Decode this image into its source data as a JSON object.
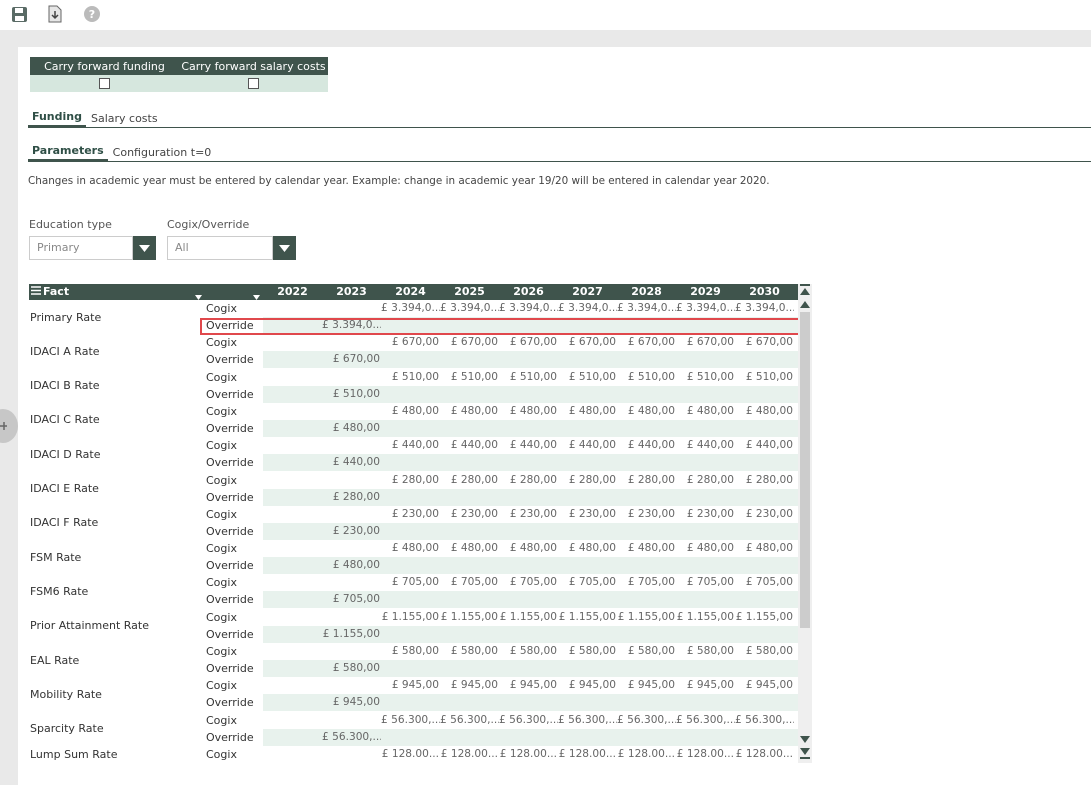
{
  "toolbar": {
    "icons": [
      "save-icon",
      "export-icon",
      "help-icon"
    ]
  },
  "carry_forward": {
    "headers": [
      "Carry forward funding",
      "Carry forward salary costs"
    ],
    "checked": [
      false,
      false
    ]
  },
  "tabs_main": [
    "Funding",
    "Salary costs"
  ],
  "tabs_sub": [
    "Parameters",
    "Configuration t=0"
  ],
  "note": "Changes in academic year must be entered by calendar year. Example: change in academic year 19/20 will be entered in calendar year 2020.",
  "filters": {
    "education_type": {
      "label": "Education type",
      "value": "Primary"
    },
    "cogix_override": {
      "label": "Cogix/Override",
      "value": "All"
    }
  },
  "grid": {
    "fact_header": "Fact",
    "years": [
      "2022",
      "2023",
      "2024",
      "2025",
      "2026",
      "2027",
      "2028",
      "2029",
      "2030"
    ],
    "sub_labels": [
      "Cogix",
      "Override"
    ],
    "rows": [
      {
        "name": "Primary Rate",
        "cogix": [
          "",
          "",
          "£ 3.394,0...",
          "£ 3.394,0...",
          "£ 3.394,0...",
          "£ 3.394,0...",
          "£ 3.394,0...",
          "£ 3.394,0...",
          "£ 3.394,0..."
        ],
        "override": [
          "",
          "£ 3.394,0...",
          "",
          "",
          "",
          "",
          "",
          "",
          ""
        ]
      },
      {
        "name": "IDACI A Rate",
        "cogix": [
          "",
          "",
          "£ 670,00",
          "£ 670,00",
          "£ 670,00",
          "£ 670,00",
          "£ 670,00",
          "£ 670,00",
          "£ 670,00"
        ],
        "override": [
          "",
          "£ 670,00",
          "",
          "",
          "",
          "",
          "",
          "",
          ""
        ]
      },
      {
        "name": "IDACI B Rate",
        "cogix": [
          "",
          "",
          "£ 510,00",
          "£ 510,00",
          "£ 510,00",
          "£ 510,00",
          "£ 510,00",
          "£ 510,00",
          "£ 510,00"
        ],
        "override": [
          "",
          "£ 510,00",
          "",
          "",
          "",
          "",
          "",
          "",
          ""
        ]
      },
      {
        "name": "IDACI C Rate",
        "cogix": [
          "",
          "",
          "£ 480,00",
          "£ 480,00",
          "£ 480,00",
          "£ 480,00",
          "£ 480,00",
          "£ 480,00",
          "£ 480,00"
        ],
        "override": [
          "",
          "£ 480,00",
          "",
          "",
          "",
          "",
          "",
          "",
          ""
        ]
      },
      {
        "name": "IDACI D Rate",
        "cogix": [
          "",
          "",
          "£ 440,00",
          "£ 440,00",
          "£ 440,00",
          "£ 440,00",
          "£ 440,00",
          "£ 440,00",
          "£ 440,00"
        ],
        "override": [
          "",
          "£ 440,00",
          "",
          "",
          "",
          "",
          "",
          "",
          ""
        ]
      },
      {
        "name": "IDACI E Rate",
        "cogix": [
          "",
          "",
          "£ 280,00",
          "£ 280,00",
          "£ 280,00",
          "£ 280,00",
          "£ 280,00",
          "£ 280,00",
          "£ 280,00"
        ],
        "override": [
          "",
          "£ 280,00",
          "",
          "",
          "",
          "",
          "",
          "",
          ""
        ]
      },
      {
        "name": "IDACI F Rate",
        "cogix": [
          "",
          "",
          "£ 230,00",
          "£ 230,00",
          "£ 230,00",
          "£ 230,00",
          "£ 230,00",
          "£ 230,00",
          "£ 230,00"
        ],
        "override": [
          "",
          "£ 230,00",
          "",
          "",
          "",
          "",
          "",
          "",
          ""
        ]
      },
      {
        "name": "FSM Rate",
        "cogix": [
          "",
          "",
          "£ 480,00",
          "£ 480,00",
          "£ 480,00",
          "£ 480,00",
          "£ 480,00",
          "£ 480,00",
          "£ 480,00"
        ],
        "override": [
          "",
          "£ 480,00",
          "",
          "",
          "",
          "",
          "",
          "",
          ""
        ]
      },
      {
        "name": "FSM6 Rate",
        "cogix": [
          "",
          "",
          "£ 705,00",
          "£ 705,00",
          "£ 705,00",
          "£ 705,00",
          "£ 705,00",
          "£ 705,00",
          "£ 705,00"
        ],
        "override": [
          "",
          "£ 705,00",
          "",
          "",
          "",
          "",
          "",
          "",
          ""
        ]
      },
      {
        "name": "Prior Attainment Rate",
        "cogix": [
          "",
          "",
          "£ 1.155,00",
          "£ 1.155,00",
          "£ 1.155,00",
          "£ 1.155,00",
          "£ 1.155,00",
          "£ 1.155,00",
          "£ 1.155,00"
        ],
        "override": [
          "",
          "£ 1.155,00",
          "",
          "",
          "",
          "",
          "",
          "",
          ""
        ]
      },
      {
        "name": "EAL Rate",
        "cogix": [
          "",
          "",
          "£ 580,00",
          "£ 580,00",
          "£ 580,00",
          "£ 580,00",
          "£ 580,00",
          "£ 580,00",
          "£ 580,00"
        ],
        "override": [
          "",
          "£ 580,00",
          "",
          "",
          "",
          "",
          "",
          "",
          ""
        ]
      },
      {
        "name": "Mobility Rate",
        "cogix": [
          "",
          "",
          "£ 945,00",
          "£ 945,00",
          "£ 945,00",
          "£ 945,00",
          "£ 945,00",
          "£ 945,00",
          "£ 945,00"
        ],
        "override": [
          "",
          "£ 945,00",
          "",
          "",
          "",
          "",
          "",
          "",
          ""
        ]
      },
      {
        "name": "Sparcity Rate",
        "cogix": [
          "",
          "",
          "£ 56.300,...",
          "£ 56.300,...",
          "£ 56.300,...",
          "£ 56.300,...",
          "£ 56.300,...",
          "£ 56.300,...",
          "£ 56.300,..."
        ],
        "override": [
          "",
          "£ 56.300,...",
          "",
          "",
          "",
          "",
          "",
          "",
          ""
        ]
      },
      {
        "name": "Lump Sum Rate",
        "cogix": [
          "",
          "",
          "£ 128.00...",
          "£ 128.00...",
          "£ 128.00...",
          "£ 128.00...",
          "£ 128.00...",
          "£ 128.00...",
          "£ 128.00..."
        ],
        "override": null
      }
    ]
  }
}
